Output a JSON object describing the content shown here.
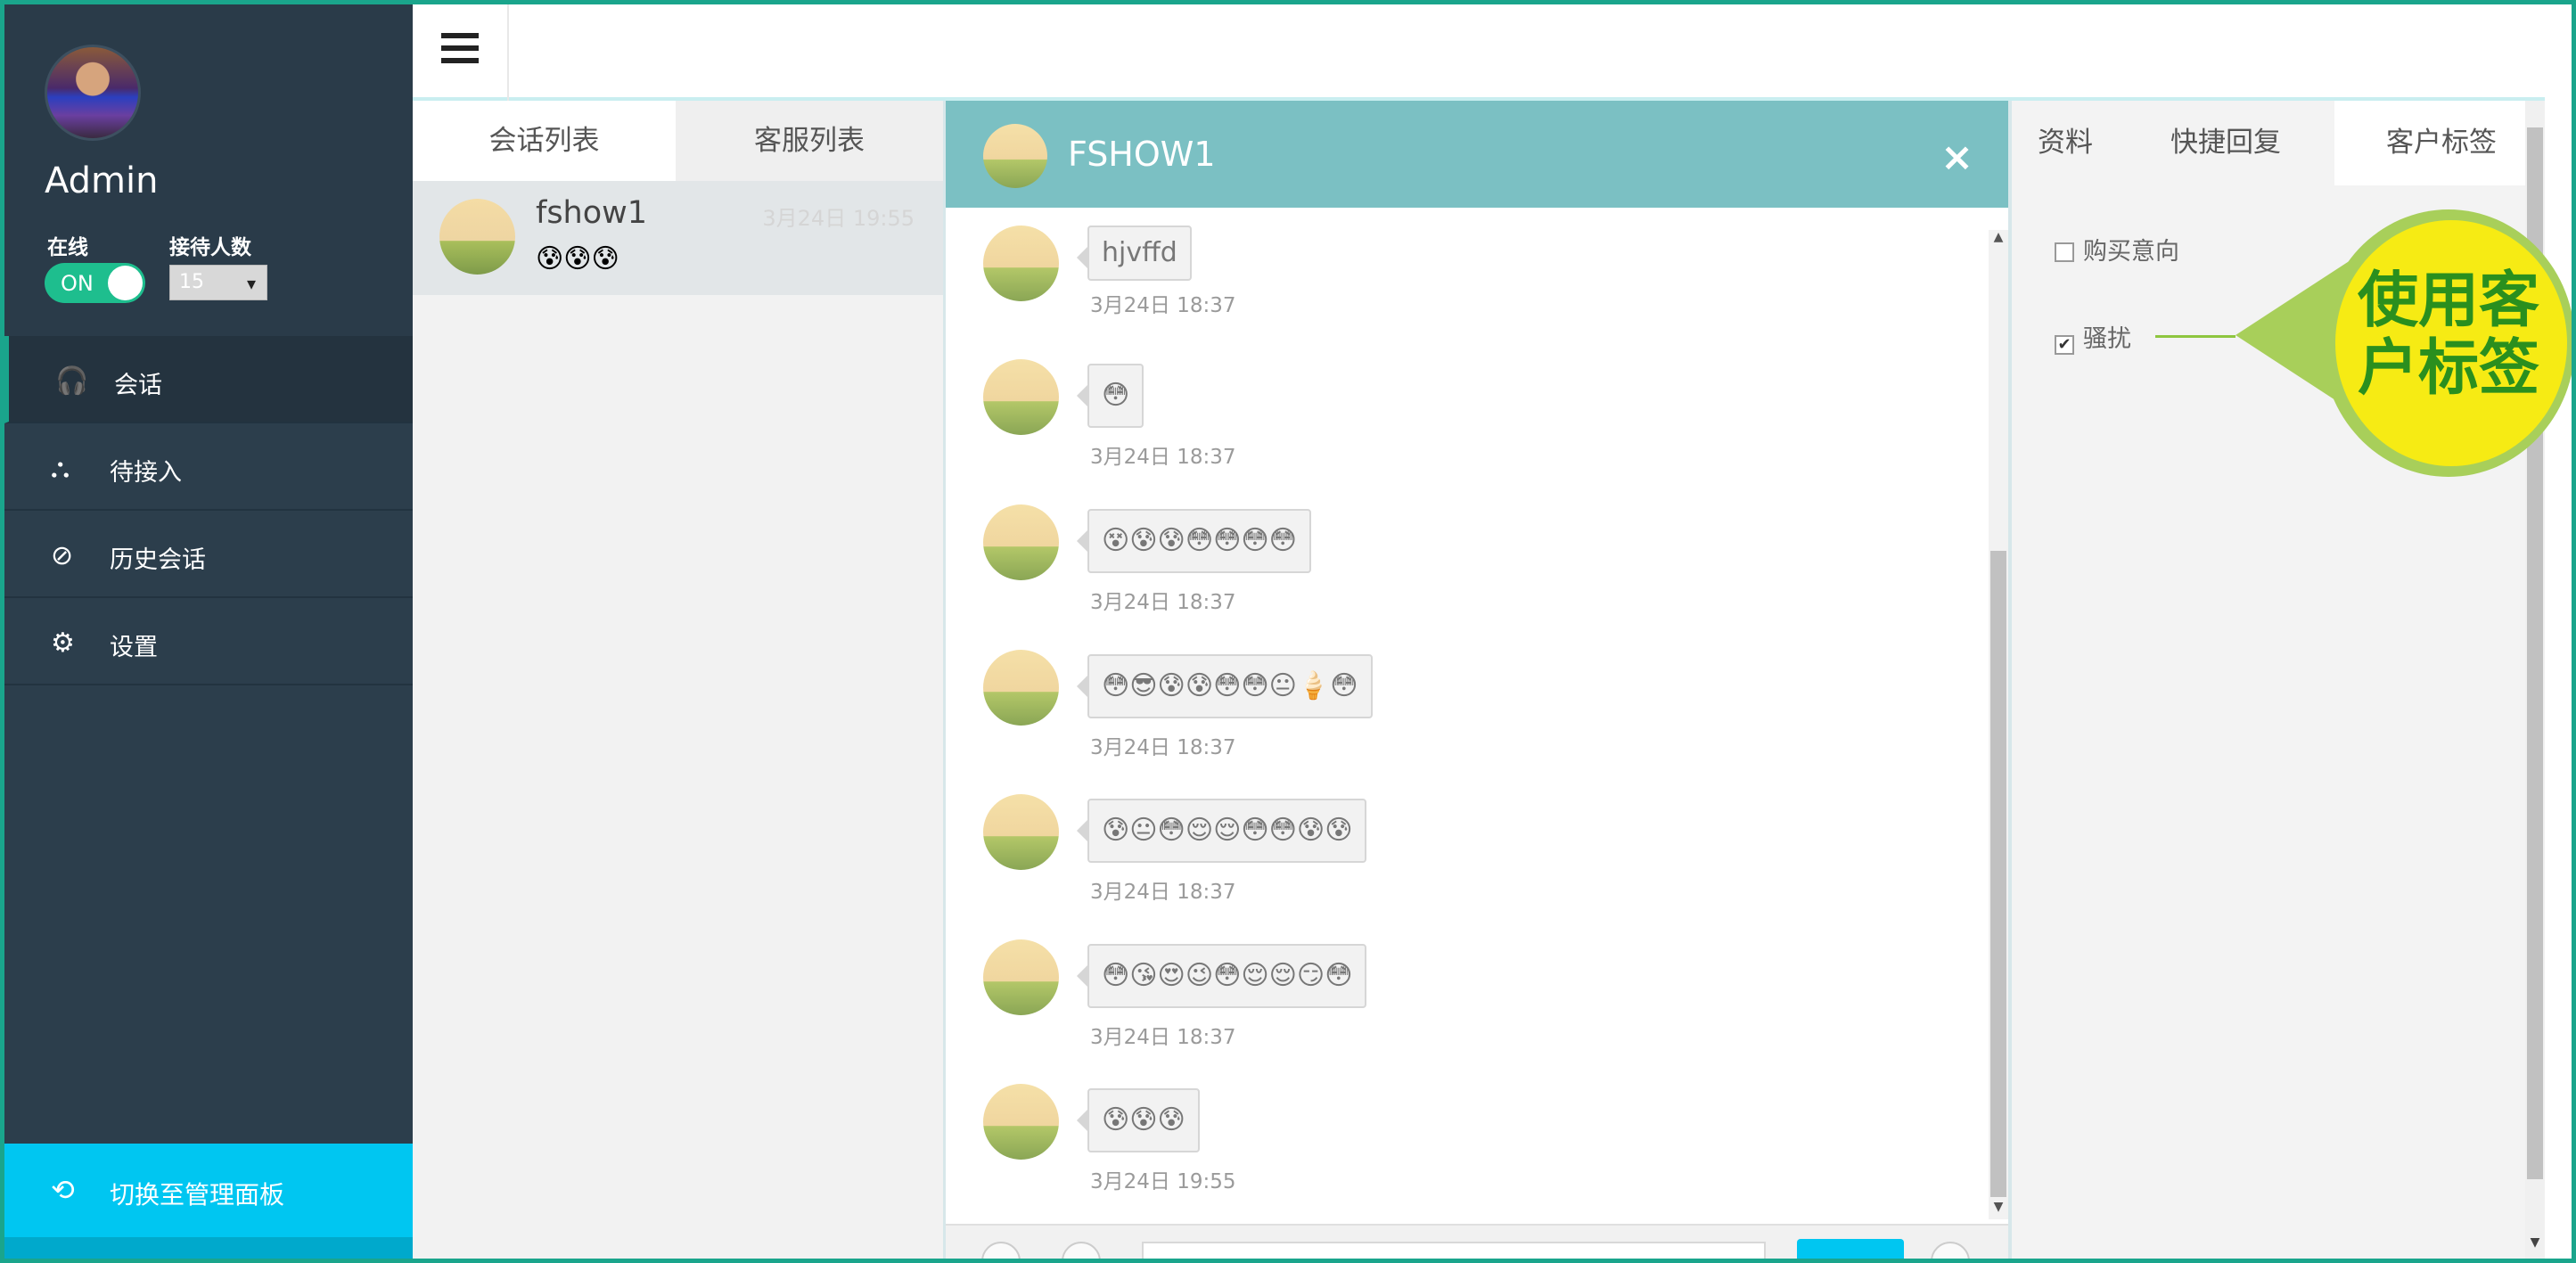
{
  "sidebar": {
    "user": "Admin",
    "status_label": "在线",
    "toggle_text": "ON",
    "receive_label": "接待人数",
    "receive_value": "15",
    "nav": [
      {
        "label": "会话",
        "icon": "headset-icon"
      },
      {
        "label": "待接入",
        "icon": "org-chart-icon"
      },
      {
        "label": "历史会话",
        "icon": "clock-icon"
      },
      {
        "label": "设置",
        "icon": "gear-icon"
      }
    ],
    "switch_label": "切换至管理面板",
    "accent_color": "#1aa58c"
  },
  "conversation_list": {
    "tabs": [
      "会话列表",
      "客服列表"
    ],
    "items": [
      {
        "name": "fshow1",
        "time": "3月24日 19:55",
        "preview": "😰😰😰"
      }
    ]
  },
  "chat": {
    "title": "FSHOW1",
    "close": "×",
    "header_color": "#7bc0c3",
    "messages": [
      {
        "text": "hjvffd",
        "time": "3月24日 18:37"
      },
      {
        "text": "😳",
        "time": "3月24日 18:37"
      },
      {
        "text": "😵😰😰😳😳😳😳",
        "time": "3月24日 18:37"
      },
      {
        "text": "😳😎😰😰😳😳😐🍦😳",
        "time": "3月24日 18:37"
      },
      {
        "text": "😰😐😳😌😌😳😳😰😰",
        "time": "3月24日 18:37"
      },
      {
        "text": "😳😘😍😉😳😌😌😏😳",
        "time": "3月24日 18:37"
      },
      {
        "text": "😰😰😰",
        "time": "3月24日 19:55"
      }
    ]
  },
  "right_panel": {
    "tabs": [
      "资料",
      "快捷回复",
      "客户标签"
    ],
    "tags": [
      {
        "label": "购买意向",
        "checked": false
      },
      {
        "label": "骚扰",
        "checked": true
      }
    ]
  },
  "callout": {
    "line1": "使用客",
    "line2": "户标签"
  }
}
